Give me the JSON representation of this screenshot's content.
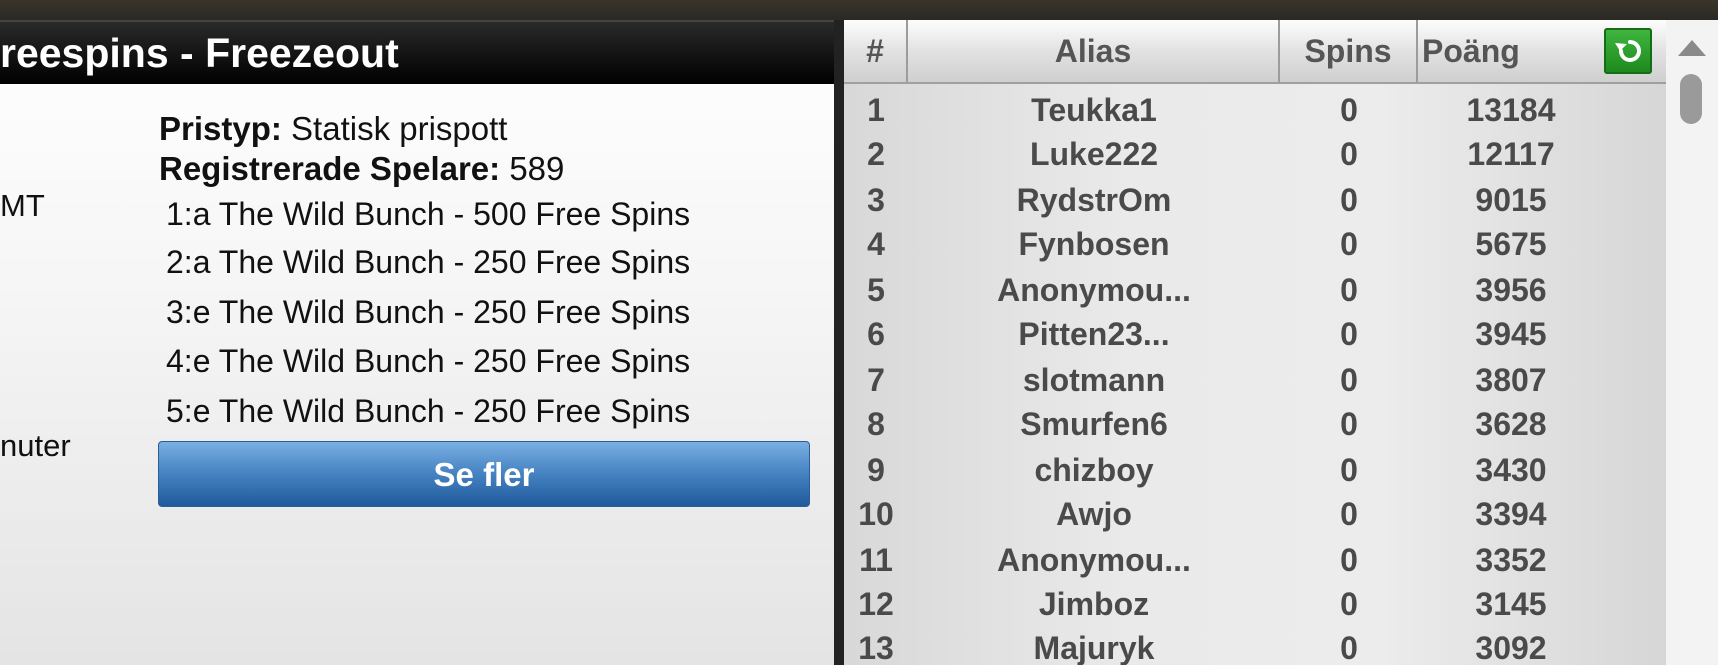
{
  "tournament": {
    "title": "reespins - Freezeout",
    "side_labels": [
      "MT",
      "nuter"
    ],
    "prize_type_label": "Pristyp:",
    "prize_type_value": "Statisk prispott",
    "registered_label": "Registrerade Spelare:",
    "registered_value": "589",
    "prizes": [
      "1:a The Wild Bunch - 500 Free Spins",
      "2:a The Wild Bunch - 250 Free Spins",
      "3:e The Wild Bunch - 250 Free Spins",
      "4:e The Wild Bunch - 250 Free Spins",
      "5:e The Wild Bunch - 250 Free Spins"
    ],
    "see_more_label": "Se fler"
  },
  "leaderboard": {
    "headers": {
      "rank": "#",
      "alias": "Alias",
      "spins": "Spins",
      "points": "Poäng"
    },
    "refresh_icon": "refresh-icon",
    "rows": [
      {
        "rank": "1",
        "alias": "Teukka1",
        "spins": "0",
        "points": "13184"
      },
      {
        "rank": "2",
        "alias": "Luke222",
        "spins": "0",
        "points": "12117"
      },
      {
        "rank": "3",
        "alias": "RydstrOm",
        "spins": "0",
        "points": "9015"
      },
      {
        "rank": "4",
        "alias": "Fynbosen",
        "spins": "0",
        "points": "5675"
      },
      {
        "rank": "5",
        "alias": "Anonymou...",
        "spins": "0",
        "points": "3956"
      },
      {
        "rank": "6",
        "alias": "Pitten23...",
        "spins": "0",
        "points": "3945"
      },
      {
        "rank": "7",
        "alias": "slotmann",
        "spins": "0",
        "points": "3807"
      },
      {
        "rank": "8",
        "alias": "Smurfen6",
        "spins": "0",
        "points": "3628"
      },
      {
        "rank": "9",
        "alias": "chizboy",
        "spins": "0",
        "points": "3430"
      },
      {
        "rank": "10",
        "alias": "Awjo",
        "spins": "0",
        "points": "3394"
      },
      {
        "rank": "11",
        "alias": "Anonymou...",
        "spins": "0",
        "points": "3352"
      },
      {
        "rank": "12",
        "alias": "Jimboz",
        "spins": "0",
        "points": "3145"
      },
      {
        "rank": "13",
        "alias": "Majuryk",
        "spins": "0",
        "points": "3092"
      }
    ]
  },
  "colors": {
    "accent": "#2f6fb3",
    "refresh": "#2e9e2e"
  }
}
